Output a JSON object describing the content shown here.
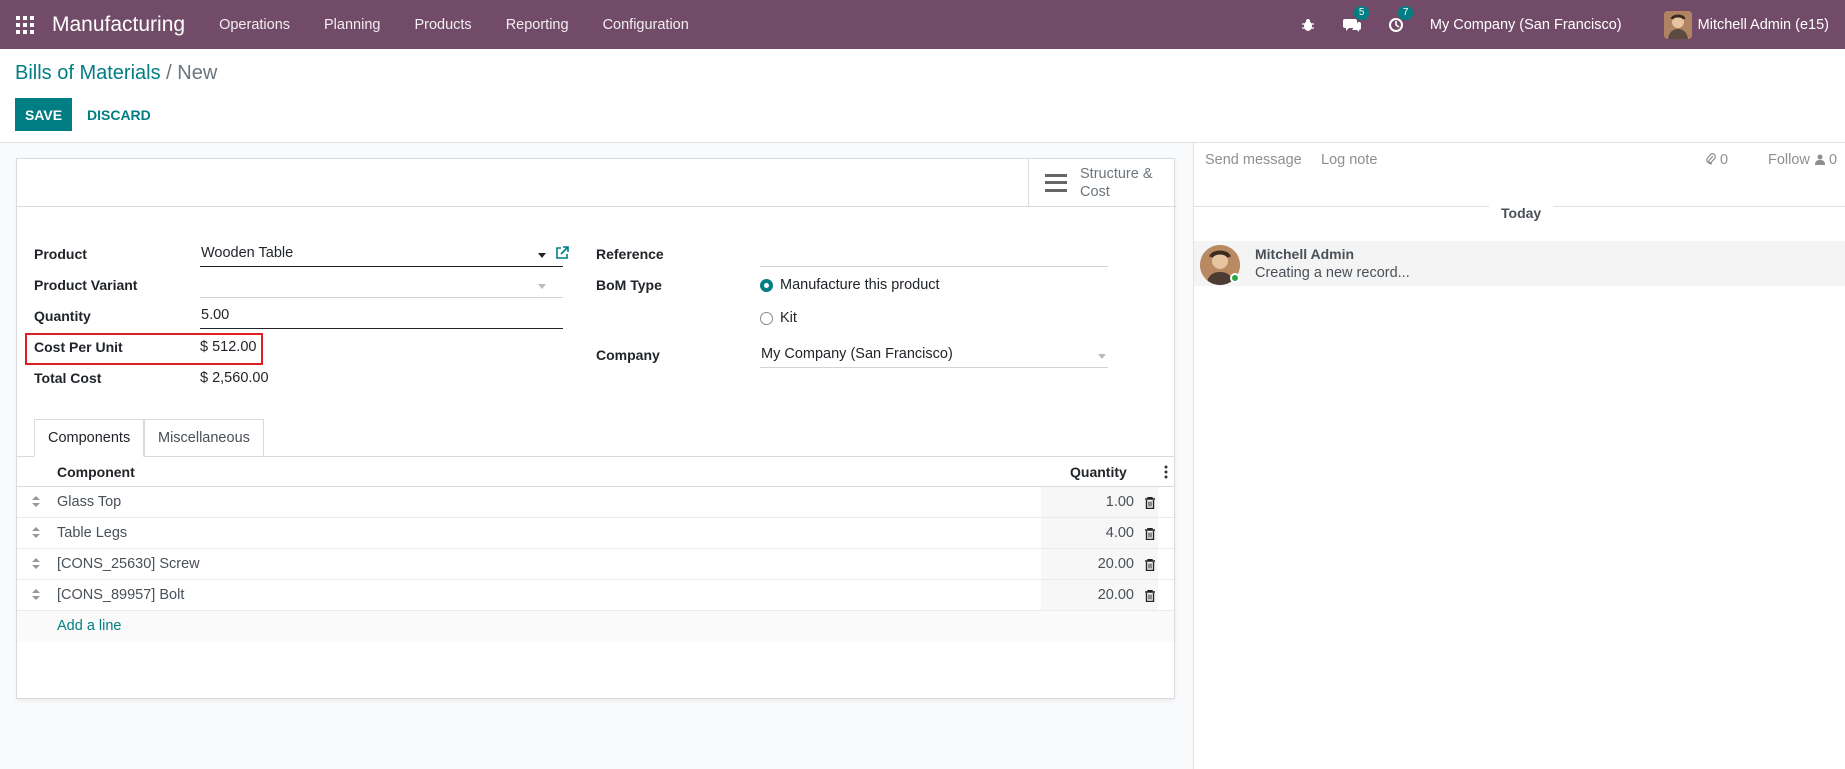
{
  "navbar": {
    "app_title": "Manufacturing",
    "menu": [
      "Operations",
      "Planning",
      "Products",
      "Reporting",
      "Configuration"
    ],
    "messages_badge": "5",
    "activities_badge": "7",
    "company": "My Company (San Francisco)",
    "user": "Mitchell Admin (e15)",
    "bar_color": "#714b67"
  },
  "control_panel": {
    "breadcrumb_parent": "Bills of Materials",
    "breadcrumb_sep": "/",
    "breadcrumb_current": "New",
    "save_label": "SAVE",
    "discard_label": "DISCARD"
  },
  "stat_button": {
    "label": "Structure & Cost"
  },
  "form": {
    "product_label": "Product",
    "product_value": "Wooden Table",
    "variant_label": "Product Variant",
    "variant_value": "",
    "quantity_label": "Quantity",
    "quantity_value": "5.00",
    "cost_per_unit_label": "Cost Per Unit",
    "cost_per_unit_value": "$ 512.00",
    "total_cost_label": "Total Cost",
    "total_cost_value": "$ 2,560.00",
    "reference_label": "Reference",
    "reference_value": "",
    "bom_type_label": "BoM Type",
    "bom_type_options": [
      "Manufacture this product",
      "Kit"
    ],
    "bom_type_selected": "Manufacture this product",
    "company_label": "Company",
    "company_value": "My Company (San Francisco)"
  },
  "tabs": [
    "Components",
    "Miscellaneous"
  ],
  "components": {
    "headers": {
      "component": "Component",
      "quantity": "Quantity"
    },
    "rows": [
      {
        "name": "Glass Top",
        "qty": "1.00"
      },
      {
        "name": "Table Legs",
        "qty": "4.00"
      },
      {
        "name": "[CONS_25630] Screw",
        "qty": "20.00"
      },
      {
        "name": "[CONS_89957] Bolt",
        "qty": "20.00"
      }
    ],
    "add_line": "Add a line"
  },
  "chatter": {
    "send_message": "Send message",
    "log_note": "Log note",
    "attachments_count": "0",
    "follow": "Follow",
    "followers_count": "0",
    "today": "Today",
    "message_author": "Mitchell Admin",
    "message_body": "Creating a new record..."
  },
  "colors": {
    "accent": "#017e84",
    "highlight": "#e02020"
  }
}
